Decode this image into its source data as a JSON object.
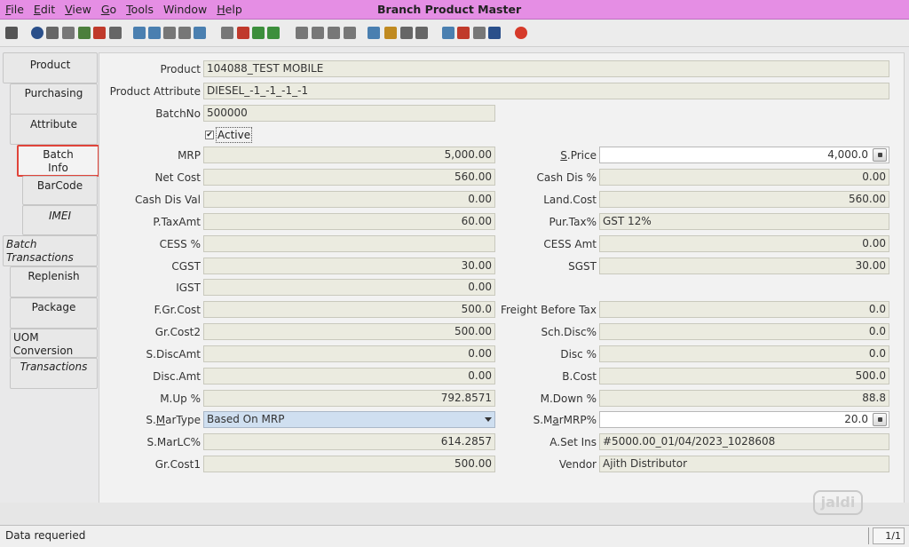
{
  "menu": {
    "items": [
      {
        "pre": "",
        "ul": "F",
        "post": "ile"
      },
      {
        "pre": "",
        "ul": "E",
        "post": "dit"
      },
      {
        "pre": "",
        "ul": "V",
        "post": "iew"
      },
      {
        "pre": "",
        "ul": "G",
        "post": "o"
      },
      {
        "pre": "",
        "ul": "T",
        "post": "ools"
      },
      {
        "pre": "Window",
        "ul": "",
        "post": ""
      },
      {
        "pre": "",
        "ul": "H",
        "post": "elp"
      }
    ]
  },
  "window": {
    "title": "Branch Product Master"
  },
  "toolbar": {
    "icons": [
      {
        "name": "undo-icon",
        "color": "#555555"
      },
      {
        "name": "help-icon",
        "color": "#2a4f8a"
      },
      {
        "name": "new-record-icon",
        "color": "#666666"
      },
      {
        "name": "copy-record-icon",
        "color": "#777777"
      },
      {
        "name": "save-new-icon",
        "color": "#4c7f3c"
      },
      {
        "name": "delete-icon",
        "color": "#c03a2b"
      },
      {
        "name": "save-icon",
        "color": "#666666"
      },
      {
        "name": "refresh-icon",
        "color": "#4a7fb0"
      },
      {
        "name": "find-icon",
        "color": "#4a7fb0"
      },
      {
        "name": "attachment-icon",
        "color": "#777777"
      },
      {
        "name": "chat-icon",
        "color": "#777777"
      },
      {
        "name": "grid-toggle-icon",
        "color": "#4a7fb0"
      },
      {
        "name": "history-icon",
        "color": "#777777"
      },
      {
        "name": "home-icon",
        "color": "#c0392b"
      },
      {
        "name": "parent-record-icon",
        "color": "#3c8f3c"
      },
      {
        "name": "detail-record-icon",
        "color": "#3c8f3c"
      },
      {
        "name": "first-record-icon",
        "color": "#777777"
      },
      {
        "name": "previous-record-icon",
        "color": "#777777"
      },
      {
        "name": "next-record-icon",
        "color": "#777777"
      },
      {
        "name": "last-record-icon",
        "color": "#777777"
      },
      {
        "name": "report-icon",
        "color": "#4a7fb0"
      },
      {
        "name": "archive-icon",
        "color": "#c08a20"
      },
      {
        "name": "print-preview-icon",
        "color": "#666666"
      },
      {
        "name": "print-icon",
        "color": "#666666"
      },
      {
        "name": "zoom-across-icon",
        "color": "#4a7fb0"
      },
      {
        "name": "workflow-icon",
        "color": "#c03a2b"
      },
      {
        "name": "request-icon",
        "color": "#777777"
      },
      {
        "name": "product-info-icon",
        "color": "#2a4f8a"
      },
      {
        "name": "close-window-icon",
        "color": "#d63a2a"
      }
    ]
  },
  "tabs": [
    {
      "label": "Product",
      "italic": false
    },
    {
      "label": "Purchasing",
      "italic": false
    },
    {
      "label": "Attribute",
      "italic": false
    },
    {
      "label": "Batch\nInfo",
      "italic": false
    },
    {
      "label": "BarCode",
      "italic": false
    },
    {
      "label": "IMEI",
      "italic": true
    },
    {
      "label": "Batch\nTransactions",
      "italic": true
    },
    {
      "label": "Replenish",
      "italic": false
    },
    {
      "label": "Package",
      "italic": false
    },
    {
      "label": "UOM\nConversion",
      "italic": false
    },
    {
      "label": "Transactions",
      "italic": true
    }
  ],
  "form": {
    "product": {
      "label": "Product",
      "value": "104088_TEST MOBILE"
    },
    "product_attribute": {
      "label": "Product Attribute",
      "value": "DIESEL_-1_-1_-1_-1"
    },
    "batch_no": {
      "label": "BatchNo",
      "value": "500000"
    },
    "active": {
      "label": "Active",
      "checked": true,
      "mark": "✔"
    },
    "mrp": {
      "label": "MRP",
      "value": "5,000.00"
    },
    "s_price": {
      "label_pre": "",
      "label_ul": "S",
      "label_post": ".Price",
      "value": "4,000.0"
    },
    "net_cost": {
      "label": "Net Cost",
      "value": "560.00"
    },
    "cash_dis_pct": {
      "label": "Cash Dis %",
      "value": "0.00"
    },
    "cash_dis_val": {
      "label": "Cash Dis Val",
      "value": "0.00"
    },
    "land_cost": {
      "label": "Land.Cost",
      "value": "560.00"
    },
    "p_tax_amt": {
      "label": "P.TaxAmt",
      "value": "60.00"
    },
    "pur_tax": {
      "label": "Pur.Tax%",
      "value": "GST 12%"
    },
    "cess_pct": {
      "label": "CESS %",
      "value": ""
    },
    "cess_amt": {
      "label": "CESS Amt",
      "value": "0.00"
    },
    "cgst": {
      "label": "CGST",
      "value": "30.00"
    },
    "sgst": {
      "label": "SGST",
      "value": "30.00"
    },
    "igst": {
      "label": "IGST",
      "value": "0.00"
    },
    "f_gr_cost": {
      "label": "F.Gr.Cost",
      "value": "500.0"
    },
    "freight_before_tax": {
      "label": "Freight Before Tax",
      "value": "0.0"
    },
    "gr_cost2": {
      "label": "Gr.Cost2",
      "value": "500.00"
    },
    "sch_disc": {
      "label": "Sch.Disc%",
      "value": "0.0"
    },
    "s_disc_amt": {
      "label": "S.DiscAmt",
      "value": "0.00"
    },
    "disc_pct": {
      "label": "Disc %",
      "value": "0.0"
    },
    "disc_amt": {
      "label": "Disc.Amt",
      "value": "0.00"
    },
    "b_cost": {
      "label": "B.Cost",
      "value": "500.0"
    },
    "m_up": {
      "label": "M.Up %",
      "value": "792.8571"
    },
    "m_down": {
      "label": "M.Down %",
      "value": "88.8"
    },
    "s_mar_type": {
      "label_pre": "S.",
      "label_ul": "M",
      "label_post": "arType",
      "value": "Based On MRP"
    },
    "s_mar_mrp": {
      "label_pre": "S.M",
      "label_ul": "a",
      "label_post": "rMRP%",
      "value": "20.0"
    },
    "s_mar_lc": {
      "label": "S.MarLC%",
      "value": "614.2857"
    },
    "a_set_ins": {
      "label": "A.Set Ins",
      "value": "#5000.00_01/04/2023_1028608"
    },
    "gr_cost1": {
      "label": "Gr.Cost1",
      "value": "500.00"
    },
    "vendor": {
      "label": "Vendor",
      "value": "Ajith Distributor"
    }
  },
  "status": {
    "message": "Data requeried",
    "page": "1/1"
  },
  "watermark": "jaldi",
  "colors": {
    "title_bar": "#e58ee4",
    "active_tab_outline": "#e0443a",
    "readonly_field": "#ebebe0",
    "editable_field": "#ffffff",
    "dropdown_field": "#cfdff0"
  }
}
